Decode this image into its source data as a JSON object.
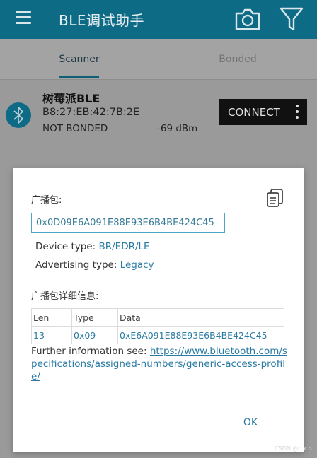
{
  "app": {
    "title": "BLE调试助手",
    "icons": {
      "menu": "menu-icon",
      "camera": "camera-icon",
      "filter": "filter-icon"
    },
    "colors": {
      "primary": "#0e6b86",
      "link": "#2a7ba2",
      "field_border": "#4ba6c4"
    }
  },
  "tabs": [
    {
      "label": "Scanner",
      "selected": true
    },
    {
      "label": "Bonded",
      "selected": false
    }
  ],
  "device": {
    "icon": "bluetooth-icon",
    "name": "树莓派BLE",
    "mac": "B8:27:EB:42:7B:2E",
    "bond_state": "NOT BONDED",
    "rssi": "-69 dBm",
    "connect_label": "CONNECT",
    "more_icon": "more-vert-icon"
  },
  "dialog": {
    "adv_label": "广播包:",
    "copy_icon": "copy-icon",
    "adv_value": "0x0D09E6A091E88E93E6B4BE424C45",
    "device_type_label": "Device type: ",
    "device_type_value": "BR/EDR/LE",
    "adv_type_label": "Advertising type: ",
    "adv_type_value": "Legacy",
    "details_label": "广播包详细信息:",
    "table": {
      "headers": [
        "Len",
        "Type",
        "Data"
      ],
      "rows": [
        [
          "13",
          "0x09",
          "0xE6A091E88E93E6B4BE424C45"
        ]
      ]
    },
    "further_text": "Further information see: ",
    "further_link": "https://www.bluetooth.com/specifications/assigned-numbers/generic-access-profile/",
    "ok_label": "OK"
  },
  "watermark": "CSDN @c x b"
}
